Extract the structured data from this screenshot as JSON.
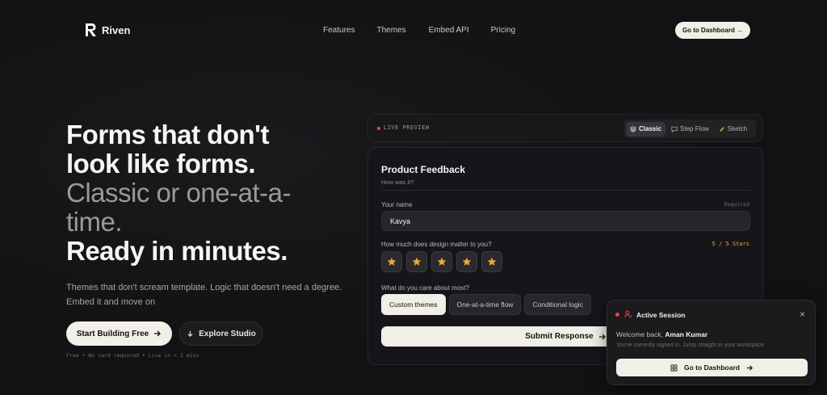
{
  "brand": {
    "name": "Riven"
  },
  "nav": {
    "links": [
      "Features",
      "Themes",
      "Embed API",
      "Pricing"
    ],
    "dashboard_button": "Go to Dashboard →"
  },
  "hero": {
    "line1": "Forms that don't",
    "line2": "look like forms.",
    "line3": "Classic or one-at-a-",
    "line4": "time.",
    "line5": "Ready in minutes.",
    "subtitle_1": "Themes that don't scream template. Logic that doesn't need a degree.",
    "subtitle_2": "Embed it and move on",
    "start_button": "Start Building Free",
    "explore_button": "Explore Studio",
    "fineprint": "Free • No card required • Live in < 2 mins"
  },
  "preview": {
    "label": "LIVE PREVIEW",
    "modes": [
      {
        "label": "Classic",
        "icon": "layers-icon",
        "active": true
      },
      {
        "label": "Step Flow",
        "icon": "chat-icon",
        "active": false
      },
      {
        "label": "Sketch",
        "icon": "pencil-icon",
        "active": false
      }
    ]
  },
  "form": {
    "title": "Product Feedback",
    "subtitle": "How was it?",
    "name_label": "Your name",
    "required_label": "Required",
    "name_value": "Kavya",
    "design_label": "How much does design matter to you?",
    "stars_label": "5 / 5 Stars",
    "rating": 5,
    "rating_max": 5,
    "care_label": "What do you care about most?",
    "chips": [
      {
        "label": "Custom themes",
        "selected": true
      },
      {
        "label": "One-at-a-time flow",
        "selected": false
      },
      {
        "label": "Conditional logic",
        "selected": false
      }
    ],
    "submit": "Submit Response"
  },
  "session": {
    "title": "Active Session",
    "welcome_prefix": "Welcome back, ",
    "user": "Aman Kumar",
    "description": "You're currently signed in. Jump straight to your workspace.",
    "button": "Go to Dashboard",
    "close": "×"
  },
  "colors": {
    "background": "#121214",
    "accent_cream": "#f1efe8",
    "star": "#e9a73a",
    "live_dot": "#e0532f",
    "session_dot": "#e5473a"
  }
}
